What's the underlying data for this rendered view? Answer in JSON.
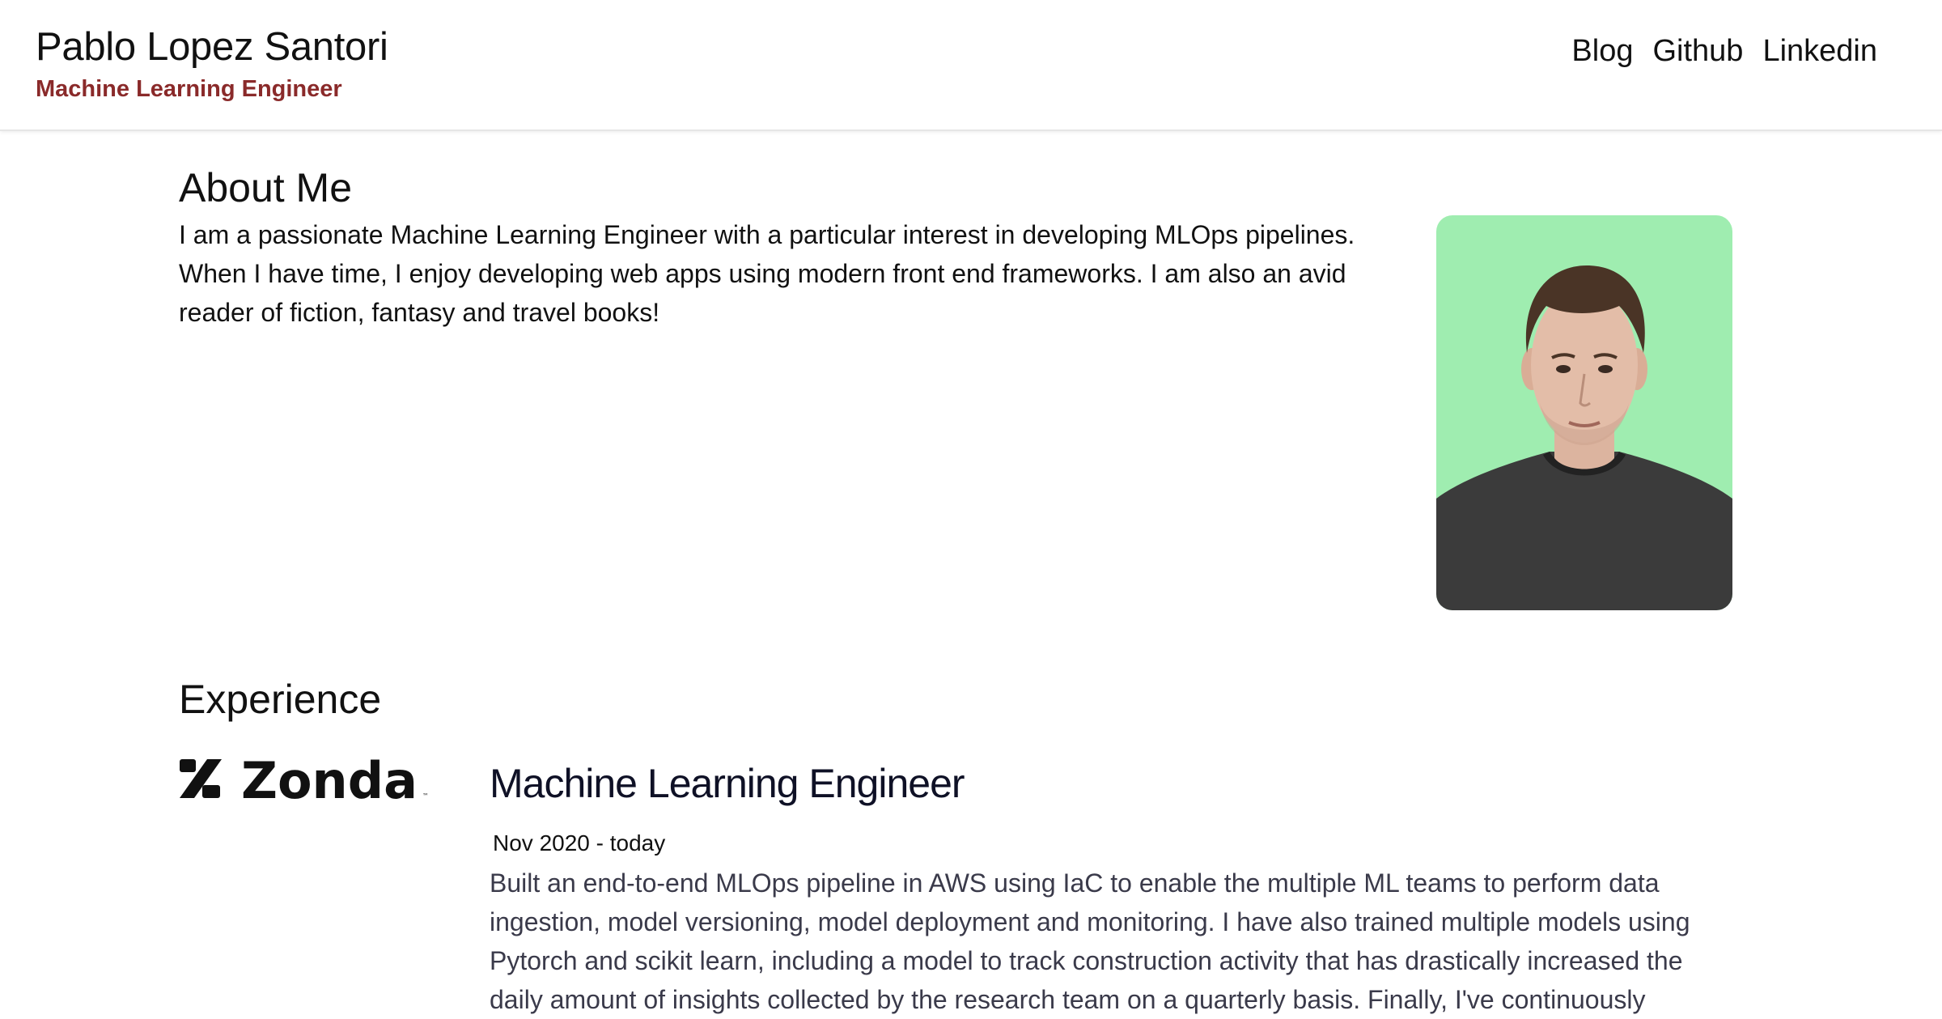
{
  "header": {
    "name": "Pablo Lopez Santori",
    "role": "Machine Learning Engineer",
    "nav": [
      {
        "label": "Blog"
      },
      {
        "label": "Github"
      },
      {
        "label": "Linkedin"
      }
    ]
  },
  "about": {
    "title": "About Me",
    "text": "I am a passionate Machine Learning Engineer with a particular interest in developing MLOps pipelines. When I have time, I enjoy developing web apps using modern front end frameworks. I am also an avid reader of fiction, fantasy and travel books!",
    "photo_background": "#9fedb0"
  },
  "experience": {
    "title": "Experience",
    "jobs": [
      {
        "company_logo_text": "Zonda",
        "title": "Machine Learning Engineer",
        "dates": "Nov 2020 - today",
        "description": "Built an end-to-end MLOps pipeline in AWS using IaC to enable the multiple ML teams to perform data ingestion, model versioning, model deployment and monitoring. I have also trained multiple models using Pytorch and scikit learn, including a model to track construction activity that has drastically increased the daily amount of insights collected by the research team on a quarterly basis. Finally, I've continuously"
      }
    ]
  },
  "colors": {
    "accent": "#8a2a2a",
    "text": "#111111",
    "muted_text": "#3a3a4a",
    "header_border": "#e6e6e6"
  }
}
